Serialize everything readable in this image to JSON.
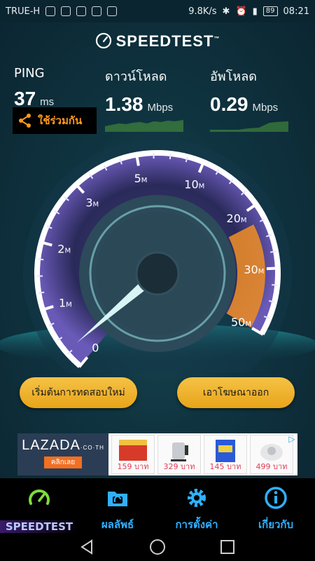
{
  "status": {
    "carrier": "TRUE-H",
    "speed": "9.8K/s",
    "battery": "89",
    "time": "08:21"
  },
  "app": {
    "brand": "SPEEDTEST",
    "tm": "™"
  },
  "results": {
    "ping": {
      "label": "PING",
      "value": "37",
      "unit": "ms"
    },
    "download": {
      "label": "ดาวน์โหลด",
      "value": "1.38",
      "unit": "Mbps"
    },
    "upload": {
      "label": "อัพโหลด",
      "value": "0.29",
      "unit": "Mbps"
    }
  },
  "share": {
    "label": "ใช้ร่วมกัน",
    "icon": "share-icon"
  },
  "gauge": {
    "ticks": [
      {
        "num": "0",
        "suffix": ""
      },
      {
        "num": "1",
        "suffix": "M"
      },
      {
        "num": "2",
        "suffix": "M"
      },
      {
        "num": "3",
        "suffix": "M"
      },
      {
        "num": "5",
        "suffix": "M"
      },
      {
        "num": "10",
        "suffix": "M"
      },
      {
        "num": "20",
        "suffix": "M"
      },
      {
        "num": "30",
        "suffix": "M"
      },
      {
        "num": "50",
        "suffix": "M"
      }
    ],
    "needle_value_mbps": 0.29,
    "accent_color": "#e8892a",
    "ring_color": "#a58cff"
  },
  "buttons": {
    "restart": "เริ่มต้นการทดสอบใหม่",
    "remove_ads": "เอาโฆษณาออก"
  },
  "ad": {
    "brand": "LAZADA",
    "brand_sub": "·CO·TH",
    "cta": "คลิกเลย",
    "products": [
      {
        "price": "159 บาท"
      },
      {
        "price": "329 บาท"
      },
      {
        "price": "145 บาท"
      },
      {
        "price": "499 บาท"
      }
    ]
  },
  "nav": [
    {
      "label": "SPEEDTEST",
      "icon": "speedometer-icon",
      "active": true
    },
    {
      "label": "ผลลัพธ์",
      "icon": "folder-icon",
      "active": false
    },
    {
      "label": "การตั้งค่า",
      "icon": "gear-icon",
      "active": false
    },
    {
      "label": "เกี่ยวกับ",
      "icon": "info-icon",
      "active": false
    }
  ]
}
